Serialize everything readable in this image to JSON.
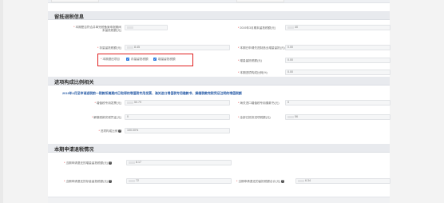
{
  "sections": {
    "retain": {
      "title": "留抵退税信息"
    },
    "progress": {
      "title": "进项构成比例相关"
    },
    "current": {
      "title": "本期申请退税情况"
    }
  },
  "retain": {
    "label_a": "本期是否符合并单完税备案申报期间",
    "label_a2": "末留抵税额(元)",
    "label_b": "2019年3月期末留抵税额(元)",
    "value_b": "40",
    "label_c": "存量留抵税额(元)",
    "value_c": "8.45",
    "label_d": "本期已申请先进制造业增量留抵(元)",
    "value_d": "0.00",
    "label_e": "增量留抵税额(元)",
    "value_e": "0.00",
    "label_f": "本期进项构成比例(%)",
    "value_f": "0.00",
    "checkbox_label": "本期退还项目",
    "option1": "存量留抵税额",
    "option2": "增量留抵税额"
  },
  "progress": {
    "notice": "2019年4月至申请退税前一税款所属期内已取得的增值税专用发票、海关进口增值税专用缴款书、解缴税款完税凭证注明的增值税额",
    "label_a": "增值税专用发票(元)",
    "value_a": "50.79",
    "label_b": "海关进口增值税专用缴款书(元)",
    "value_b": "0",
    "label_c": "解缴税款完税凭证(元)",
    "value_c": "0",
    "label_d": "全部已抵扣进项税额(元)",
    "value_d": "56",
    "label_e": "进项构成比例",
    "value_e": "100.00%"
  },
  "current": {
    "label_a": "当期申请退还的增量留抵税额(元)",
    "value_a": "8.17",
    "label_b": "当期申请退还的存量留抵税额(元)",
    "value_b": "72",
    "label_c": "当期申请退还的留抵税额合计(元)",
    "value_c": "6.34"
  }
}
